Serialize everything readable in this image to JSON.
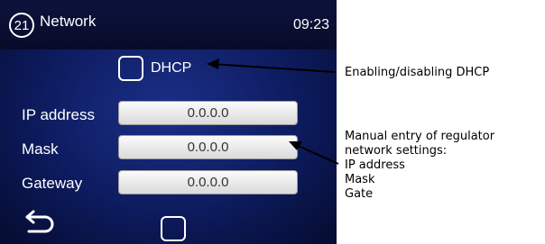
{
  "header": {
    "screen_number": "21",
    "title": "Network",
    "time": "09:23"
  },
  "dhcp": {
    "label": "DHCP",
    "checked": false
  },
  "fields": [
    {
      "label": "IP address",
      "value": "0.0.0.0"
    },
    {
      "label": "Mask",
      "value": "0.0.0.0"
    },
    {
      "label": "Gateway",
      "value": "0.0.0.0"
    }
  ],
  "annotations": {
    "dhcp": "Enabling/disabling DHCP",
    "manual": "Manual entry of regulator\nnetwork settings:\nIP address\nMask\nGate"
  },
  "icons": {
    "back": "back-arrow-icon",
    "screen_number": "circle-number-badge"
  },
  "colors": {
    "screen_bg": "#0d1b5e",
    "header_bg": "#080c2a",
    "field_bg": "#e8e8e8",
    "text": "#ffffff"
  }
}
